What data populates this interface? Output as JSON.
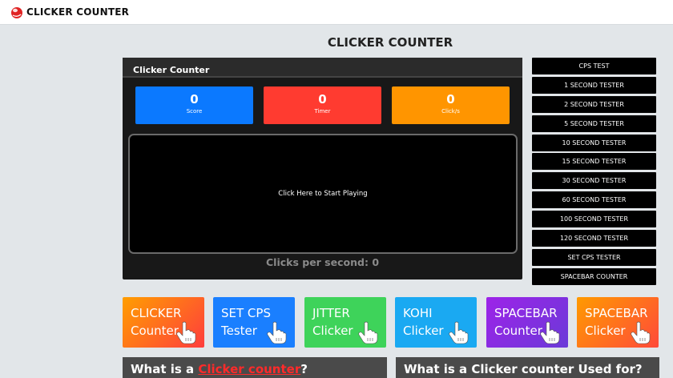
{
  "header": {
    "brand": "CLICKER COUNTER",
    "logo_icon": "mouse-logo"
  },
  "page": {
    "title": "CLICKER COUNTER"
  },
  "game": {
    "panel_title": "Clicker Counter",
    "stats": [
      {
        "value": "0",
        "label": "Score",
        "color": "#0b79ff"
      },
      {
        "value": "0",
        "label": "Timer",
        "color": "#ff3b30"
      },
      {
        "value": "0",
        "label": "Click/s",
        "color": "#ff9500"
      }
    ],
    "play_prompt": "Click Here to Start Playing",
    "cps_label": "Clicks per second:",
    "cps_value": "0"
  },
  "side_menu": {
    "items": [
      "CPS TEST",
      "1 SECOND TESTER",
      "2 SECOND TESTER",
      "5 SECOND TESTER",
      "10 SECOND TESTER",
      "15 SECOND TESTER",
      "30 SECOND TESTER",
      "60 SECOND TESTER",
      "100 SECOND TESTER",
      "120 SECOND TESTER",
      "SET CPS TESTER",
      "SPACEBAR COUNTER"
    ]
  },
  "tiles": [
    {
      "line1": "CLICKER",
      "line2": "Counter",
      "icon": "hand-pointer-icon"
    },
    {
      "line1": "SET CPS",
      "line2": "Tester",
      "icon": "hand-pointer-icon"
    },
    {
      "line1": "JITTER",
      "line2": "Clicker",
      "icon": "hand-pointer-icon"
    },
    {
      "line1": "KOHI",
      "line2": "Clicker",
      "icon": "hand-pointer-icon"
    },
    {
      "line1": "SPACEBAR",
      "line2": "Counter",
      "icon": "hand-pointer-icon"
    },
    {
      "line1": "SPACEBAR",
      "line2": "Clicker",
      "icon": "hand-pointer-icon"
    }
  ],
  "info": {
    "left_prefix": "What is a ",
    "left_link": "Clicker counter",
    "left_suffix": "?",
    "right": "What is a Clicker counter Used for?"
  },
  "colors": {
    "accent_link": "#ff2a2a",
    "page_bg": "#e2e6e9",
    "panel_bg": "#181818"
  }
}
